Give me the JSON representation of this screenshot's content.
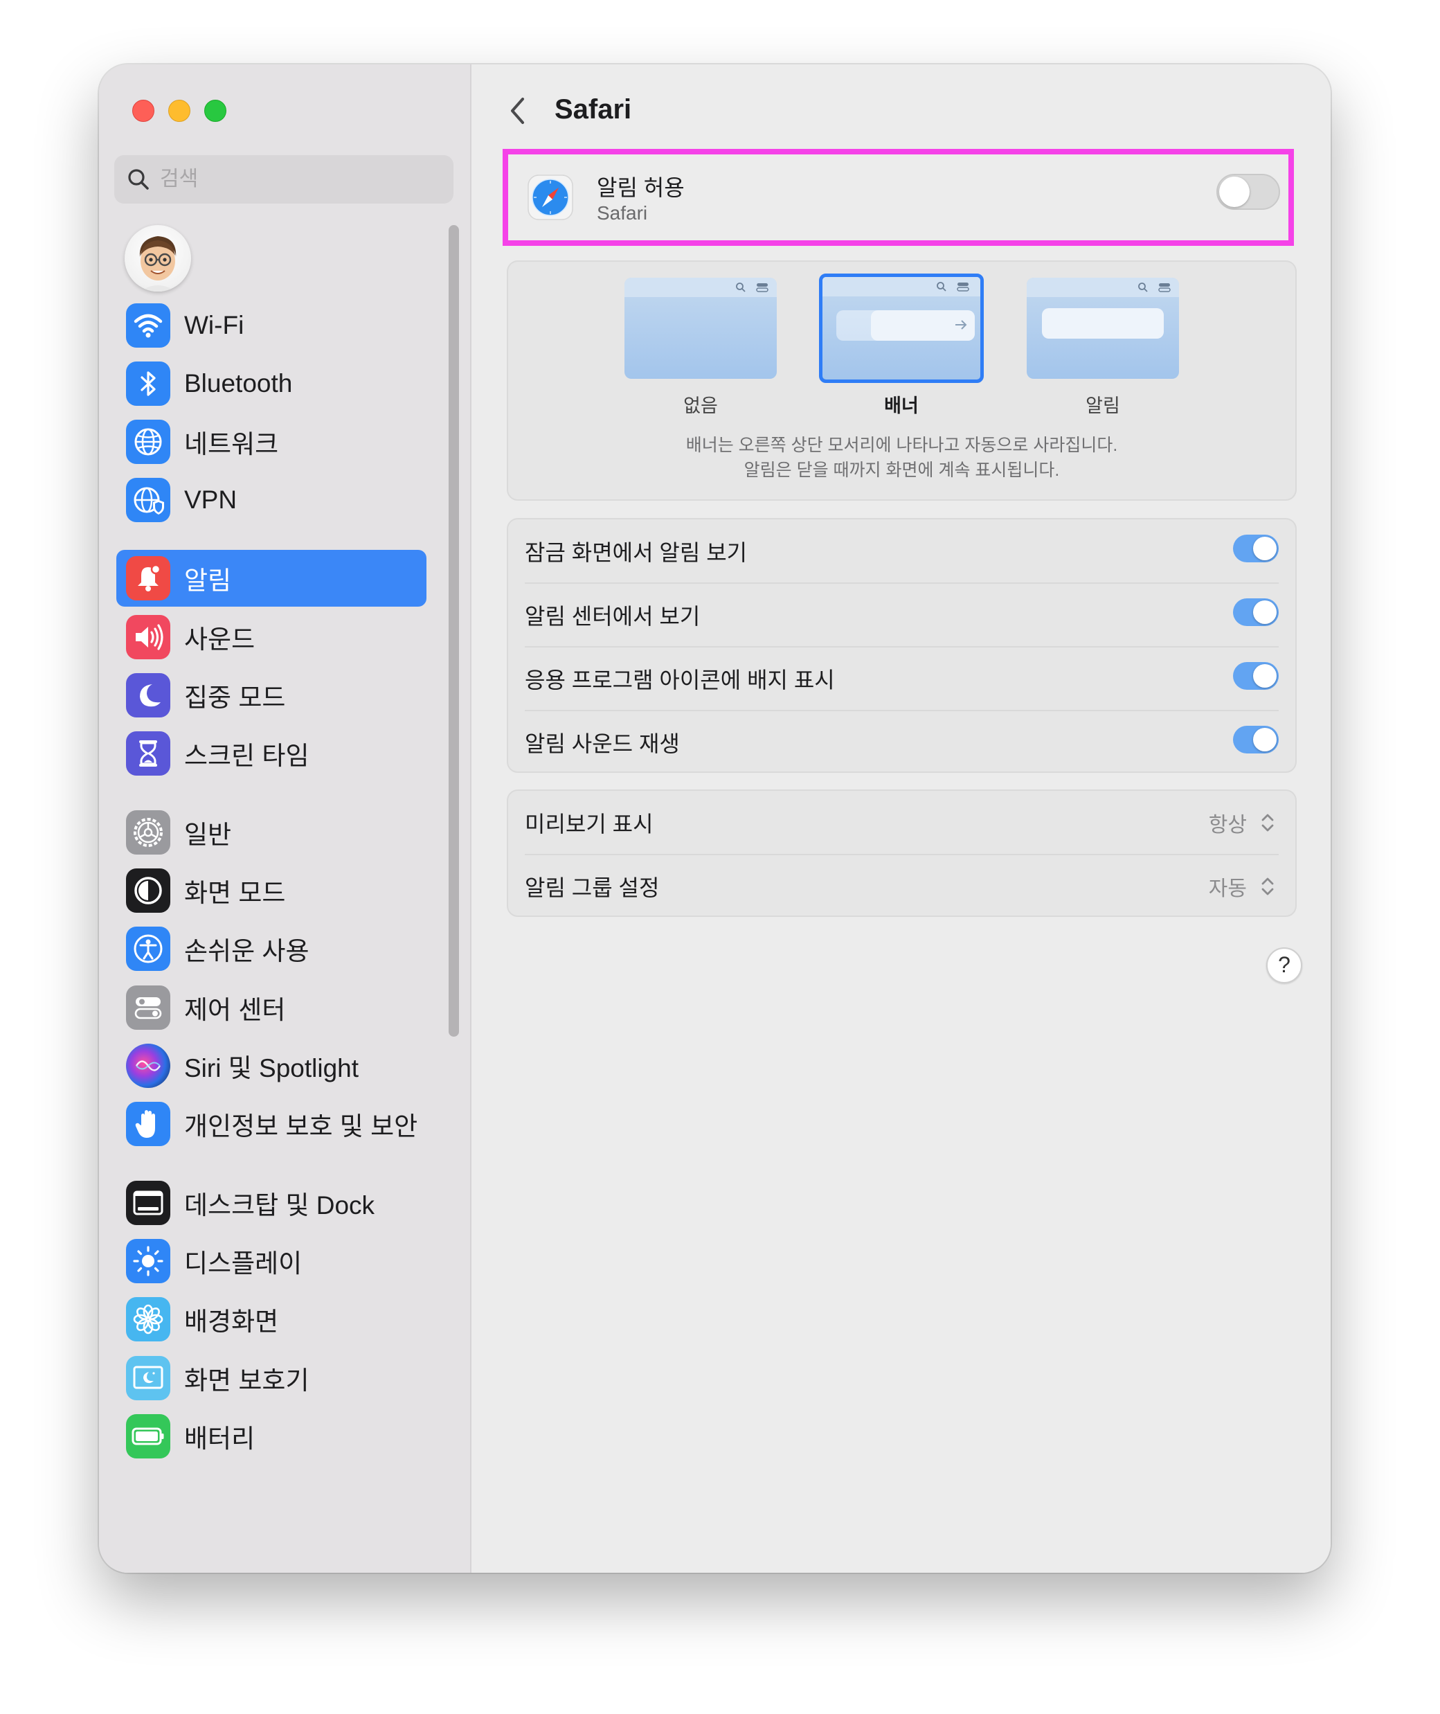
{
  "window": {
    "controls": {
      "close": "close-button",
      "minimize": "minimize-button",
      "zoom": "zoom-button"
    }
  },
  "sidebar": {
    "search_placeholder": "검색",
    "sections": [
      {
        "items": [
          {
            "label": "Wi-Fi",
            "icon": "wifi-icon",
            "color": "#2f86f6"
          },
          {
            "label": "Bluetooth",
            "icon": "bluetooth-icon",
            "color": "#2f86f6"
          },
          {
            "label": "네트워크",
            "icon": "globe-icon",
            "color": "#2f86f6"
          },
          {
            "label": "VPN",
            "icon": "vpn-globe-icon",
            "color": "#2f86f6"
          }
        ]
      },
      {
        "items": [
          {
            "label": "알림",
            "icon": "bell-icon",
            "color": "#f04a45",
            "selected": true
          },
          {
            "label": "사운드",
            "icon": "speaker-icon",
            "color": "#f1485f"
          },
          {
            "label": "집중 모드",
            "icon": "moon-icon",
            "color": "#5a57d8"
          },
          {
            "label": "스크린 타임",
            "icon": "hourglass-icon",
            "color": "#5a57d8"
          }
        ]
      },
      {
        "items": [
          {
            "label": "일반",
            "icon": "gear-icon",
            "color": "#8e8e93"
          },
          {
            "label": "화면 모드",
            "icon": "appearance-icon",
            "color": "#1d1d1f"
          },
          {
            "label": "손쉬운 사용",
            "icon": "accessibility-icon",
            "color": "#2f86f6"
          },
          {
            "label": "제어 센터",
            "icon": "control-center-icon",
            "color": "#8e8e93"
          },
          {
            "label": "Siri 및 Spotlight",
            "icon": "siri-icon",
            "color": "#3b2a6e"
          },
          {
            "label": "개인정보 보호 및 보안",
            "icon": "hand-icon",
            "color": "#2f86f6"
          }
        ]
      },
      {
        "items": [
          {
            "label": "데스크탑 및 Dock",
            "icon": "dock-icon",
            "color": "#1d1d1f"
          },
          {
            "label": "디스플레이",
            "icon": "sun-icon",
            "color": "#2f86f6"
          },
          {
            "label": "배경화면",
            "icon": "flower-icon",
            "color": "#40b8f0"
          },
          {
            "label": "화면 보호기",
            "icon": "screensaver-icon",
            "color": "#52c0ee"
          },
          {
            "label": "배터리",
            "icon": "battery-icon",
            "color": "#34c759"
          }
        ]
      }
    ]
  },
  "content": {
    "title": "Safari",
    "allow": {
      "title": "알림 허용",
      "subtitle": "Safari",
      "enabled": false
    },
    "styles": {
      "options": [
        "없음",
        "배너",
        "알림"
      ],
      "selected": "배너",
      "description_line1": "배너는 오른쪽 상단 모서리에 나타나고 자동으로 사라집니다.",
      "description_line2": "알림은 닫을 때까지 화면에 계속 표시됩니다."
    },
    "toggles": [
      {
        "label": "잠금 화면에서 알림 보기",
        "on": true
      },
      {
        "label": "알림 센터에서 보기",
        "on": true
      },
      {
        "label": "응용 프로그램 아이콘에 배지 표시",
        "on": true
      },
      {
        "label": "알림 사운드 재생",
        "on": true
      }
    ],
    "selects": [
      {
        "label": "미리보기 표시",
        "value": "항상"
      },
      {
        "label": "알림 그룹 설정",
        "value": "자동"
      }
    ],
    "help": "?"
  },
  "colors": {
    "accent": "#3b87f7",
    "highlight": "#f542e8"
  }
}
